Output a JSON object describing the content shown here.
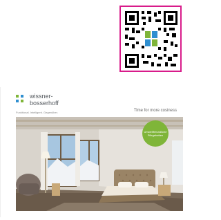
{
  "brochure": {
    "brand_name": "wissner-\nbosserhoff",
    "brand_tagline": "Funktional. Intelligent. Gegenüber.",
    "slogan": "Time for more cosiness",
    "badge_text": "Umweltfreundliche Pflegebetten",
    "colors": {
      "brand_green": "#7fb539",
      "brand_blue": "#2f8fd0",
      "qr_frame": "#d81b8a"
    }
  },
  "qr": {
    "icon": "qr-code-icon",
    "center_logo": "wissner-bosserhoff-logo-icon"
  }
}
